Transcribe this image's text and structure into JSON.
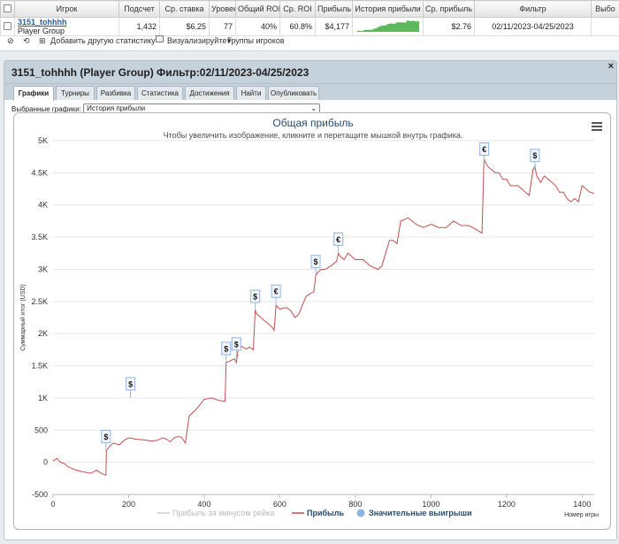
{
  "table": {
    "headers": [
      "Игрок",
      "Подсчет",
      "Ср. ставка",
      "Уровен",
      "Общий ROI",
      "Ср. ROI",
      "Прибыль",
      "История прибыли",
      "Ср. прибыль",
      "Фильтр",
      "Выбо"
    ],
    "row": {
      "player_name": "3151_tohhhh",
      "player_group": "Player Group",
      "count": "1,432",
      "avg_stake": "$6.25",
      "level": "77",
      "total_roi": "40%",
      "avg_roi": "60.8%",
      "profit": "$4,177",
      "avg_profit": "$2.76",
      "filter": "02/11/2023-04/25/2023"
    }
  },
  "toolbar": {
    "add_stat": "Добавить другую статистику",
    "visualize": "Визуализируйте",
    "player_groups": "Группы игроков"
  },
  "panel": {
    "title": "3151_tohhhh (Player Group) Фильтр:02/11/2023-04/25/2023",
    "close": "×",
    "tabs": [
      "Графики",
      "Турниры",
      "Разбивка",
      "Статистика",
      "Достижения",
      "Найти",
      "Опубликовать"
    ],
    "select_label": "Выбранные графики:",
    "select_value": "История прибыли",
    "select_arrow": "⌄"
  },
  "colors": {
    "profit_line": "#c0504d",
    "sparkline": "#5cb85c",
    "big_win_marker": "#8db3e2",
    "rake_line": "#cccccc"
  },
  "chart_data": {
    "type": "line",
    "title": "Общая прибыль",
    "subtitle": "Чтобы увеличить изображение, кликните и перетащите мышкой внутрь графика.",
    "xlabel": "Номер игры",
    "ylabel": "Суммарный итог (USD)",
    "xlim": [
      0,
      1432
    ],
    "ylim": [
      -500,
      5000
    ],
    "x_ticks": [
      "0",
      "200",
      "400",
      "600",
      "800",
      "1000",
      "1200",
      "1400"
    ],
    "y_ticks": [
      "-500",
      "0",
      "500",
      "1K",
      "1.5K",
      "2K",
      "2.5K",
      "3K",
      "3.5K",
      "4K",
      "4.5K",
      "5K"
    ],
    "legend": [
      "Прибыль за минусом рейка",
      "Прибыль",
      "Значительные выигрыши"
    ],
    "legend_position": "bottom",
    "menu_icon": "hamburger-menu-icon",
    "series": [
      {
        "name": "Прибыль",
        "x": [
          0,
          10,
          20,
          30,
          40,
          60,
          80,
          100,
          115,
          130,
          140,
          141,
          150,
          160,
          175,
          190,
          200,
          220,
          240,
          260,
          275,
          290,
          300,
          310,
          320,
          330,
          340,
          350,
          360,
          380,
          400,
          420,
          440,
          450,
          455,
          458,
          470,
          480,
          485,
          490,
          500,
          510,
          520,
          530,
          535,
          540,
          550,
          560,
          570,
          580,
          585,
          590,
          600,
          610,
          620,
          630,
          640,
          650,
          660,
          670,
          680,
          690,
          695,
          700,
          710,
          720,
          735,
          745,
          750,
          755,
          760,
          770,
          780,
          800,
          820,
          840,
          860,
          870,
          880,
          890,
          900,
          910,
          920,
          940,
          960,
          980,
          1000,
          1020,
          1040,
          1060,
          1080,
          1100,
          1120,
          1135,
          1140,
          1141,
          1150,
          1160,
          1170,
          1180,
          1190,
          1200,
          1210,
          1220,
          1230,
          1240,
          1250,
          1260,
          1270,
          1275,
          1280,
          1290,
          1300,
          1310,
          1320,
          1330,
          1340,
          1350,
          1360,
          1370,
          1380,
          1390,
          1400,
          1410,
          1420,
          1432
        ],
        "values": [
          20,
          60,
          0,
          -20,
          -70,
          -120,
          -150,
          -170,
          -120,
          -180,
          -200,
          180,
          250,
          300,
          270,
          350,
          380,
          360,
          350,
          330,
          340,
          380,
          360,
          320,
          380,
          400,
          390,
          300,
          720,
          830,
          980,
          1000,
          960,
          950,
          950,
          1550,
          1580,
          1610,
          1550,
          1760,
          1800,
          1760,
          1790,
          1750,
          2360,
          2300,
          2250,
          2200,
          2150,
          2100,
          2050,
          2440,
          2380,
          2400,
          2400,
          2350,
          2250,
          2300,
          2450,
          2580,
          2620,
          2650,
          2900,
          2950,
          3000,
          3000,
          3050,
          3100,
          3120,
          3250,
          3200,
          3150,
          3250,
          3150,
          3150,
          3050,
          3000,
          3050,
          3250,
          3450,
          3450,
          3400,
          3750,
          3800,
          3700,
          3650,
          3700,
          3650,
          3650,
          3750,
          3680,
          3680,
          3620,
          3560,
          4650,
          4700,
          4600,
          4550,
          4500,
          4500,
          4400,
          4400,
          4300,
          4300,
          4300,
          4250,
          4200,
          4150,
          4550,
          4600,
          4450,
          4350,
          4450,
          4400,
          4350,
          4300,
          4200,
          4200,
          4100,
          4050,
          4100,
          4050,
          4300,
          4250,
          4200,
          4180
        ]
      }
    ],
    "big_wins": [
      {
        "x": 140,
        "y": 180,
        "label": "$"
      },
      {
        "x": 458,
        "y": 1550,
        "label": "$"
      },
      {
        "x": 535,
        "y": 2360,
        "label": "$"
      },
      {
        "x": 590,
        "y": 2440,
        "label": "€"
      },
      {
        "x": 695,
        "y": 2900,
        "label": "$"
      },
      {
        "x": 755,
        "y": 3250,
        "label": "€"
      },
      {
        "x": 1141,
        "y": 4650,
        "label": "€"
      },
      {
        "x": 1275,
        "y": 4550,
        "label": "$"
      },
      {
        "x": 205,
        "y": 1000,
        "label": "$"
      },
      {
        "x": 485,
        "y": 1620,
        "label": "$"
      }
    ]
  }
}
